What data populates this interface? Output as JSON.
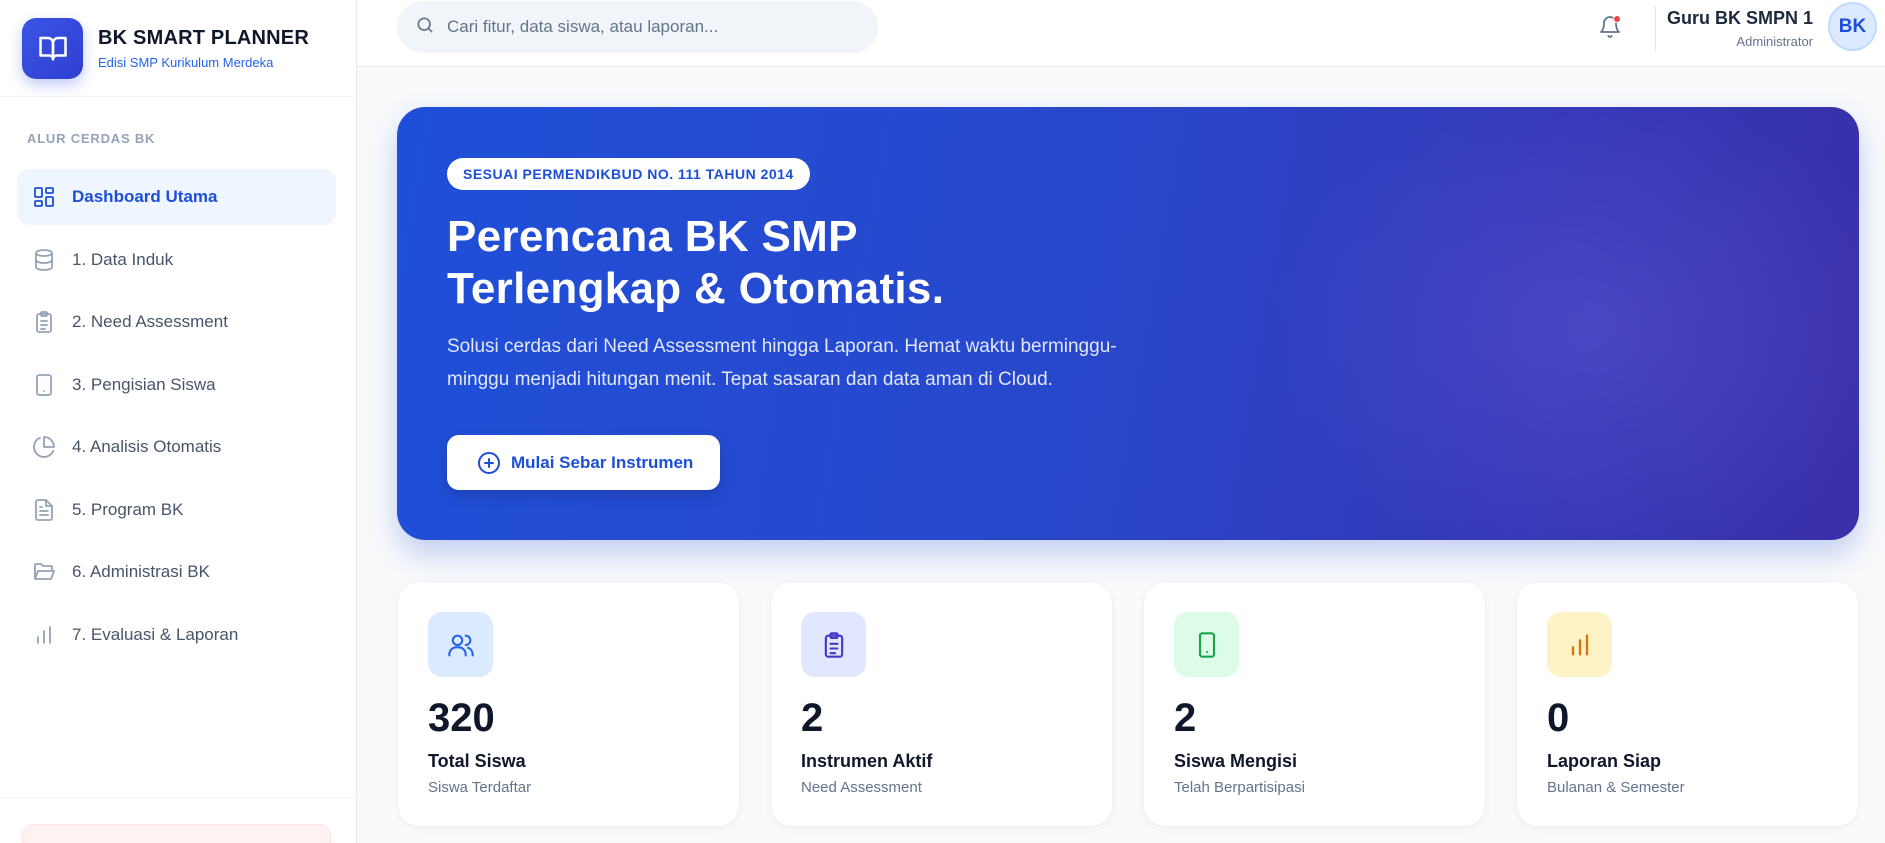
{
  "brand": {
    "title": "BK SMART PLANNER",
    "subtitle": "Edisi SMP Kurikulum Merdeka"
  },
  "sidebar": {
    "section_label": "ALUR CERDAS BK",
    "items": [
      {
        "label": "Dashboard Utama",
        "icon": "dashboard-grid-icon",
        "active": true
      },
      {
        "label": "1. Data Induk",
        "icon": "database-icon"
      },
      {
        "label": "2. Need Assessment",
        "icon": "clipboard-list-icon"
      },
      {
        "label": "3. Pengisian Siswa",
        "icon": "tablet-icon"
      },
      {
        "label": "4. Analisis Otomatis",
        "icon": "pie-chart-icon"
      },
      {
        "label": "5. Program BK",
        "icon": "document-icon"
      },
      {
        "label": "6. Administrasi BK",
        "icon": "folder-open-icon"
      },
      {
        "label": "7. Evaluasi & Laporan",
        "icon": "bar-chart-icon"
      }
    ]
  },
  "header": {
    "search_placeholder": "Cari fitur, data siswa, atau laporan...",
    "user_name": "Guru BK SMPN 1",
    "user_role": "Administrator",
    "avatar_initials": "BK"
  },
  "hero": {
    "badge": "SESUAI PERMENDIKBUD NO. 111 TAHUN 2014",
    "title_line1": "Perencana BK SMP",
    "title_line2": "Terlengkap & Otomatis.",
    "description": "Solusi cerdas dari Need Assessment hingga Laporan. Hemat waktu berminggu-minggu menjadi hitungan menit. Tepat sasaran dan data aman di Cloud.",
    "button_label": "Mulai Sebar Instrumen"
  },
  "stats": [
    {
      "value": "320",
      "title": "Total Siswa",
      "subtitle": "Siswa Terdaftar",
      "icon": "users-icon",
      "bg": "#dbeafe",
      "fg": "#2563eb"
    },
    {
      "value": "2",
      "title": "Instrumen Aktif",
      "subtitle": "Need Assessment",
      "icon": "clipboard-list-icon",
      "bg": "#e0e7ff",
      "fg": "#4338ca"
    },
    {
      "value": "2",
      "title": "Siswa Mengisi",
      "subtitle": "Telah Berpartisipasi",
      "icon": "tablet-icon",
      "bg": "#dcfce7",
      "fg": "#16a34a"
    },
    {
      "value": "0",
      "title": "Laporan Siap",
      "subtitle": "Bulanan & Semester",
      "icon": "bar-chart-icon",
      "bg": "#fef3c7",
      "fg": "#d97706"
    }
  ],
  "colors": {
    "accent": "#1d4ed8",
    "hero_start": "#1f4fd8",
    "hero_end": "#3a2fa8",
    "notification": "#ef4444"
  }
}
